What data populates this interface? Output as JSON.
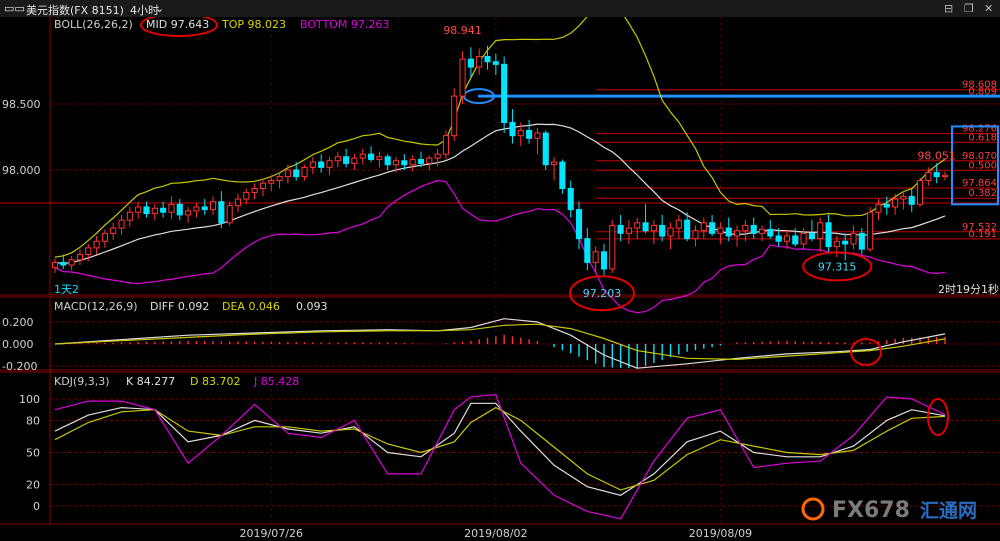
{
  "window": {
    "title": "美元指数(FX 8151)",
    "period": "4小时",
    "period_arrow": "⌄",
    "btn_min": "⊟",
    "btn_max": "❐",
    "btn_close": "✕"
  },
  "boll": {
    "label": "BOLL(26,26,2)",
    "mid": "MID 97.643",
    "top": "TOP 98.023",
    "bottom": "BOTTOM 97.263"
  },
  "macd": {
    "label": "MACD(12,26,9)",
    "diff": "DIFF 0.092",
    "dea": "DEA 0.046",
    "val": "0.093"
  },
  "kdj": {
    "label": "KDJ(9,3,3)",
    "k": "K 84.277",
    "d": "D 83.702",
    "j": "J 85.428"
  },
  "status": {
    "left": "1天2",
    "right": "2时19分1秒"
  },
  "watermark": {
    "text": "FX678",
    "sub": "汇通网"
  },
  "colors": {
    "up": "#ff3333",
    "down": "#00e5ff",
    "mid": "#e0e0e0",
    "top": "#c8c800",
    "bottom": "#e000e0",
    "fib": "#c80000",
    "annot": "#e00000",
    "neck": "#1e90ff"
  },
  "chart_data": [
    {
      "type": "candlestick",
      "title": "美元指数(FX 8151) 4小时 BOLL(26,26,2)",
      "x_labels": [
        "2019/07/26",
        "2019/08/02",
        "2019/08/09"
      ],
      "y_ticks": [
        98.5,
        98.0
      ],
      "y_tick_labels": [
        "98.500",
        "98.000"
      ],
      "ylim": [
        97.05,
        99.15
      ],
      "annotations": [
        "98.941",
        "97.203",
        "97.315",
        "98.051"
      ],
      "fib_levels": [
        {
          "price": 98.608,
          "label": "98.608"
        },
        {
          "price": 98.557,
          "label": "0.809"
        },
        {
          "price": 98.276,
          "label": "98.276"
        },
        {
          "price": 98.21,
          "label": "0.618"
        },
        {
          "price": 98.07,
          "label": "98.070"
        },
        {
          "price": 97.998,
          "label": "0.500"
        },
        {
          "price": 97.864,
          "label": "97.864"
        },
        {
          "price": 97.786,
          "label": "0.382"
        },
        {
          "price": 97.532,
          "label": "97.532"
        },
        {
          "price": 97.478,
          "label": "0.191"
        }
      ],
      "neckline": 98.56,
      "ohlc": [
        [
          97.26,
          97.33,
          97.22,
          97.3
        ],
        [
          97.3,
          97.36,
          97.25,
          97.28
        ],
        [
          97.28,
          97.35,
          97.24,
          97.32
        ],
        [
          97.32,
          97.4,
          97.28,
          97.36
        ],
        [
          97.36,
          97.44,
          97.31,
          97.41
        ],
        [
          97.41,
          97.5,
          97.36,
          97.46
        ],
        [
          97.46,
          97.55,
          97.41,
          97.52
        ],
        [
          97.52,
          97.6,
          97.47,
          97.56
        ],
        [
          97.56,
          97.66,
          97.51,
          97.62
        ],
        [
          97.62,
          97.72,
          97.57,
          97.68
        ],
        [
          97.68,
          97.76,
          97.63,
          97.72
        ],
        [
          97.72,
          97.76,
          97.64,
          97.67
        ],
        [
          97.67,
          97.74,
          97.62,
          97.71
        ],
        [
          97.71,
          97.76,
          97.64,
          97.68
        ],
        [
          97.68,
          97.8,
          97.63,
          97.74
        ],
        [
          97.74,
          97.78,
          97.62,
          97.66
        ],
        [
          97.66,
          97.72,
          97.6,
          97.69
        ],
        [
          97.69,
          97.75,
          97.64,
          97.72
        ],
        [
          97.72,
          97.78,
          97.66,
          97.7
        ],
        [
          97.7,
          97.8,
          97.66,
          97.76
        ],
        [
          97.76,
          97.84,
          97.56,
          97.6
        ],
        [
          97.6,
          97.76,
          97.58,
          97.73
        ],
        [
          97.73,
          97.82,
          97.68,
          97.78
        ],
        [
          97.78,
          97.86,
          97.74,
          97.83
        ],
        [
          97.83,
          97.9,
          97.78,
          97.86
        ],
        [
          97.86,
          97.93,
          97.8,
          97.9
        ],
        [
          97.9,
          97.96,
          97.84,
          97.92
        ],
        [
          97.92,
          97.98,
          97.86,
          97.95
        ],
        [
          97.95,
          98.04,
          97.9,
          98.0
        ],
        [
          98.0,
          98.06,
          97.92,
          97.95
        ],
        [
          97.95,
          98.04,
          97.92,
          98.02
        ],
        [
          98.02,
          98.1,
          97.97,
          98.06
        ],
        [
          98.06,
          98.12,
          97.98,
          98.02
        ],
        [
          98.02,
          98.1,
          97.96,
          98.07
        ],
        [
          98.07,
          98.14,
          98.02,
          98.1
        ],
        [
          98.1,
          98.16,
          98.02,
          98.05
        ],
        [
          98.05,
          98.12,
          98.0,
          98.09
        ],
        [
          98.09,
          98.16,
          98.04,
          98.12
        ],
        [
          98.12,
          98.18,
          98.06,
          98.08
        ],
        [
          98.08,
          98.14,
          98.02,
          98.1
        ],
        [
          98.1,
          98.12,
          98.0,
          98.04
        ],
        [
          98.04,
          98.1,
          97.98,
          98.07
        ],
        [
          98.07,
          98.12,
          98.0,
          98.04
        ],
        [
          98.04,
          98.11,
          97.99,
          98.08
        ],
        [
          98.08,
          98.14,
          98.02,
          98.05
        ],
        [
          98.05,
          98.11,
          98.0,
          98.09
        ],
        [
          98.09,
          98.16,
          98.03,
          98.12
        ],
        [
          98.12,
          98.3,
          98.08,
          98.26
        ],
        [
          98.26,
          98.62,
          98.22,
          98.56
        ],
        [
          98.56,
          98.9,
          98.5,
          98.84
        ],
        [
          98.84,
          98.93,
          98.7,
          98.78
        ],
        [
          98.78,
          98.92,
          98.72,
          98.86
        ],
        [
          98.86,
          98.941,
          98.76,
          98.82
        ],
        [
          98.82,
          98.88,
          98.72,
          98.8
        ],
        [
          98.8,
          98.86,
          98.28,
          98.36
        ],
        [
          98.36,
          98.46,
          98.2,
          98.26
        ],
        [
          98.26,
          98.36,
          98.18,
          98.3
        ],
        [
          98.3,
          98.38,
          98.2,
          98.24
        ],
        [
          98.24,
          98.32,
          98.12,
          98.28
        ],
        [
          98.28,
          98.3,
          98.0,
          98.04
        ],
        [
          98.04,
          98.1,
          97.92,
          98.06
        ],
        [
          98.06,
          98.08,
          97.82,
          97.86
        ],
        [
          97.86,
          97.92,
          97.64,
          97.7
        ],
        [
          97.7,
          97.76,
          97.4,
          97.48
        ],
        [
          97.48,
          97.56,
          97.24,
          97.3
        ],
        [
          97.3,
          97.42,
          97.22,
          97.38
        ],
        [
          97.38,
          97.44,
          97.203,
          97.25
        ],
        [
          97.25,
          97.62,
          97.22,
          97.58
        ],
        [
          97.58,
          97.66,
          97.46,
          97.52
        ],
        [
          97.52,
          97.62,
          97.44,
          97.56
        ],
        [
          97.56,
          97.64,
          97.48,
          97.6
        ],
        [
          97.6,
          97.74,
          97.52,
          97.54
        ],
        [
          97.54,
          97.62,
          97.44,
          97.58
        ],
        [
          97.58,
          97.66,
          97.46,
          97.5
        ],
        [
          97.5,
          97.6,
          97.4,
          97.56
        ],
        [
          97.56,
          97.66,
          97.48,
          97.62
        ],
        [
          97.62,
          97.68,
          97.46,
          97.48
        ],
        [
          97.48,
          97.58,
          97.42,
          97.54
        ],
        [
          97.54,
          97.64,
          97.48,
          97.6
        ],
        [
          97.6,
          97.66,
          97.5,
          97.52
        ],
        [
          97.52,
          97.6,
          97.44,
          97.56
        ],
        [
          97.56,
          97.64,
          97.46,
          97.5
        ],
        [
          97.5,
          97.58,
          97.42,
          97.54
        ],
        [
          97.54,
          97.62,
          97.46,
          97.58
        ],
        [
          97.58,
          97.64,
          97.48,
          97.52
        ],
        [
          97.52,
          97.58,
          97.46,
          97.55
        ],
        [
          97.55,
          97.62,
          97.48,
          97.5
        ],
        [
          97.5,
          97.56,
          97.42,
          97.46
        ],
        [
          97.46,
          97.54,
          97.4,
          97.5
        ],
        [
          97.5,
          97.56,
          97.42,
          97.44
        ],
        [
          97.44,
          97.56,
          97.4,
          97.52
        ],
        [
          97.52,
          97.62,
          97.46,
          97.48
        ],
        [
          97.48,
          97.64,
          97.38,
          97.6
        ],
        [
          97.6,
          97.66,
          97.38,
          97.42
        ],
        [
          97.42,
          97.5,
          97.34,
          97.46
        ],
        [
          97.46,
          97.52,
          97.315,
          97.44
        ],
        [
          97.44,
          97.58,
          97.4,
          97.52
        ],
        [
          97.52,
          97.56,
          97.36,
          97.4
        ],
        [
          97.4,
          97.72,
          97.38,
          97.68
        ],
        [
          97.68,
          97.78,
          97.62,
          97.74
        ],
        [
          97.74,
          97.8,
          97.66,
          97.72
        ],
        [
          97.72,
          97.82,
          97.66,
          97.78
        ],
        [
          97.78,
          97.84,
          97.7,
          97.8
        ],
        [
          97.8,
          97.86,
          97.68,
          97.74
        ],
        [
          97.74,
          97.94,
          97.72,
          97.92
        ],
        [
          97.92,
          98.02,
          97.88,
          97.98
        ],
        [
          97.98,
          98.051,
          97.9,
          97.95
        ],
        [
          97.95,
          97.99,
          97.92,
          97.96
        ]
      ]
    },
    {
      "type": "line",
      "title": "MACD(12,26,9)",
      "y_ticks": [
        0.2,
        0.0,
        -0.2
      ],
      "y_tick_labels": [
        "0.200",
        "0.000",
        "-0.200"
      ],
      "ylim": [
        -0.3,
        0.3
      ],
      "series": [
        {
          "name": "DIFF",
          "x": [
            0,
            8,
            16,
            24,
            32,
            40,
            46,
            50,
            54,
            58,
            62,
            66,
            70,
            76,
            82,
            88,
            94,
            98,
            102,
            107
          ],
          "values": [
            0.0,
            0.04,
            0.08,
            0.1,
            0.12,
            0.13,
            0.12,
            0.15,
            0.23,
            0.2,
            0.08,
            -0.1,
            -0.22,
            -0.18,
            -0.13,
            -0.09,
            -0.07,
            -0.05,
            0.02,
            0.092
          ]
        },
        {
          "name": "DEA",
          "x": [
            0,
            8,
            16,
            24,
            32,
            40,
            46,
            50,
            54,
            58,
            62,
            66,
            70,
            76,
            82,
            88,
            94,
            98,
            102,
            107
          ],
          "values": [
            0.0,
            0.03,
            0.06,
            0.09,
            0.11,
            0.12,
            0.12,
            0.13,
            0.17,
            0.18,
            0.14,
            0.05,
            -0.06,
            -0.13,
            -0.14,
            -0.11,
            -0.08,
            -0.06,
            -0.02,
            0.046
          ]
        },
        {
          "name": "MACD",
          "x": [
            0,
            8,
            16,
            24,
            32,
            40,
            46,
            50,
            54,
            58,
            62,
            66,
            70,
            76,
            82,
            88,
            94,
            98,
            102,
            107
          ],
          "values": [
            0.0,
            0.02,
            0.04,
            0.03,
            0.02,
            0.02,
            0.0,
            0.04,
            0.12,
            0.04,
            -0.12,
            -0.3,
            -0.32,
            -0.1,
            0.02,
            0.04,
            0.02,
            0.02,
            0.08,
            0.093
          ]
        }
      ]
    },
    {
      "type": "line",
      "title": "KDJ(9,3,3)",
      "y_ticks": [
        100,
        80,
        50,
        20,
        0
      ],
      "ylim": [
        -12,
        110
      ],
      "series": [
        {
          "name": "K",
          "x": [
            0,
            4,
            8,
            12,
            16,
            20,
            24,
            28,
            32,
            36,
            40,
            44,
            48,
            50,
            53,
            56,
            60,
            64,
            68,
            72,
            76,
            80,
            84,
            88,
            92,
            96,
            100,
            103,
            107
          ],
          "values": [
            70,
            85,
            92,
            90,
            60,
            66,
            80,
            72,
            68,
            74,
            50,
            46,
            68,
            96,
            96,
            70,
            38,
            18,
            10,
            30,
            60,
            70,
            50,
            46,
            46,
            56,
            80,
            90,
            84.277
          ]
        },
        {
          "name": "D",
          "x": [
            0,
            4,
            8,
            12,
            16,
            20,
            24,
            28,
            32,
            36,
            40,
            44,
            48,
            50,
            53,
            56,
            60,
            64,
            68,
            72,
            76,
            80,
            84,
            88,
            92,
            96,
            100,
            103,
            107
          ],
          "values": [
            62,
            78,
            88,
            90,
            70,
            66,
            74,
            74,
            70,
            72,
            58,
            50,
            60,
            78,
            92,
            80,
            55,
            30,
            15,
            24,
            48,
            62,
            56,
            50,
            48,
            52,
            70,
            82,
            83.702
          ]
        },
        {
          "name": "J",
          "x": [
            0,
            4,
            8,
            12,
            16,
            20,
            24,
            28,
            32,
            36,
            40,
            44,
            48,
            50,
            53,
            56,
            60,
            64,
            68,
            72,
            76,
            80,
            84,
            88,
            92,
            96,
            100,
            103,
            107
          ],
          "values": [
            90,
            98,
            98,
            90,
            40,
            66,
            95,
            68,
            64,
            80,
            30,
            30,
            90,
            102,
            104,
            40,
            10,
            -5,
            -12,
            42,
            82,
            90,
            36,
            40,
            42,
            66,
            102,
            100,
            85.428
          ]
        }
      ]
    }
  ]
}
